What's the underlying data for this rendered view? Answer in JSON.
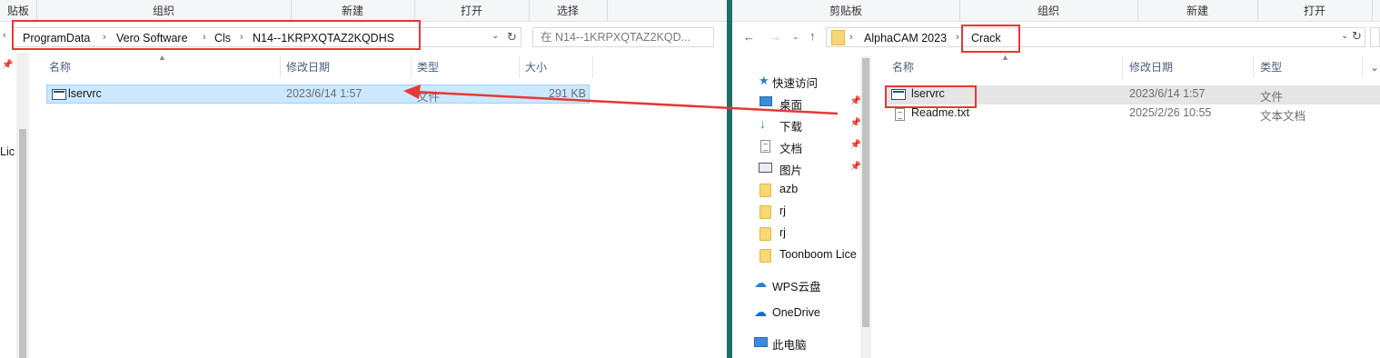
{
  "left": {
    "ribbon": {
      "clipboard": "贴板",
      "organize": "组织",
      "new": "新建",
      "open": "打开",
      "select": "选择"
    },
    "address": {
      "crumbs": [
        "ProgramData",
        "Vero Software",
        "Cls",
        "N14--1KRPXQTAZ2KQDHS"
      ]
    },
    "search": {
      "placeholder": "在 N14--1KRPXQTAZ2KQD..."
    },
    "columns": {
      "name": "名称",
      "date": "修改日期",
      "type": "类型",
      "size": "大小"
    },
    "files": [
      {
        "name": "lservrc",
        "date": "2023/6/14 1:57",
        "type": "文件",
        "size": "291 KB"
      }
    ],
    "nav_cut_text": "Lic"
  },
  "right": {
    "ribbon": {
      "clipboard": "剪贴板",
      "organize": "组织",
      "new": "新建",
      "open": "打开"
    },
    "address": {
      "crumbs": [
        "AlphaCAM 2023",
        "Crack"
      ]
    },
    "columns": {
      "name": "名称",
      "date": "修改日期",
      "type": "类型"
    },
    "files": [
      {
        "name": "lservrc",
        "date": "2023/6/14 1:57",
        "type": "文件"
      },
      {
        "name": "Readme.txt",
        "date": "2025/2/26 10:55",
        "type": "文本文档"
      }
    ],
    "nav": {
      "quick_access": "快速访问",
      "items": [
        "桌面",
        "下载",
        "文档",
        "图片",
        "azb",
        "rj",
        "rj",
        "Toonboom Lice"
      ],
      "wps": "WPS云盘",
      "onedrive": "OneDrive",
      "this_pc": "此电脑"
    }
  },
  "colors": {
    "annotation": "#e53935",
    "selection": "#cce8ff",
    "split_bar": "#1f6f66"
  }
}
